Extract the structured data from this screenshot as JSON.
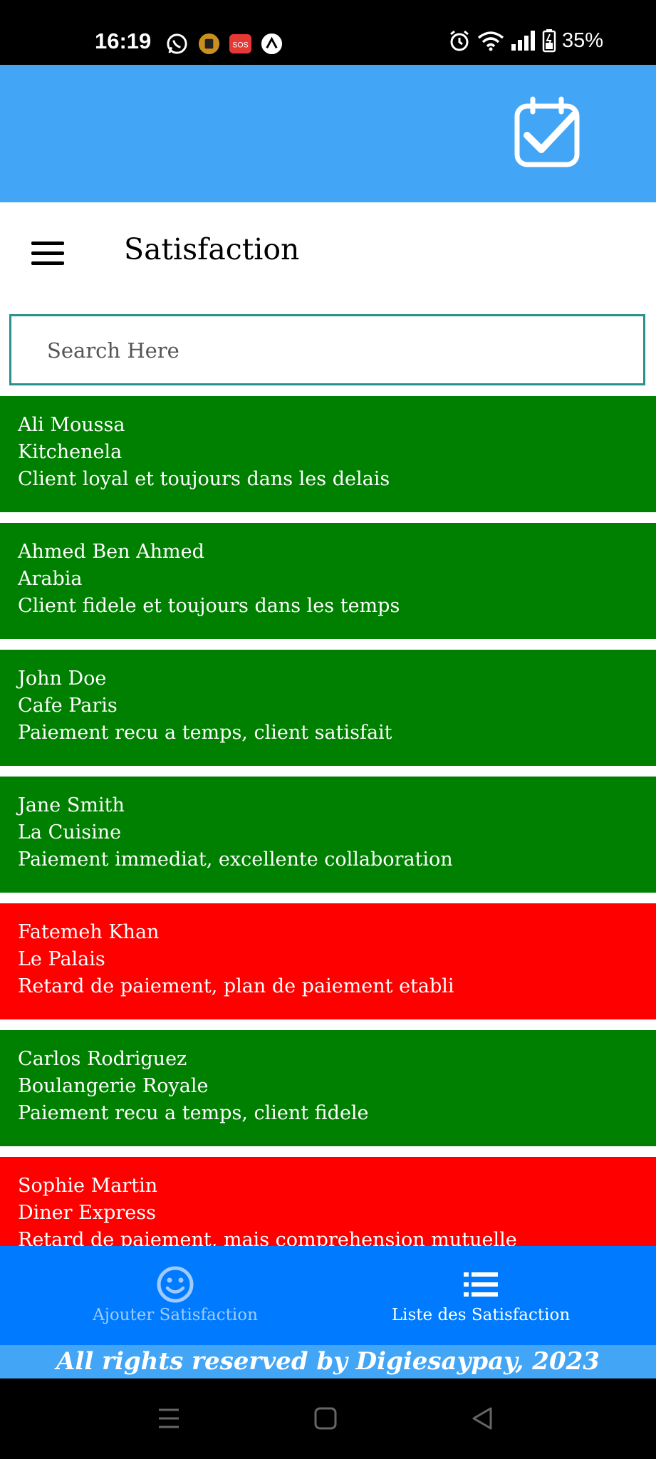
{
  "status_bar": {
    "time": "16:19",
    "battery": "35%",
    "icons_left": [
      "whatsapp-icon",
      "app-icon",
      "sos-icon",
      "nav-app-icon"
    ],
    "icons_right": [
      "alarm-icon",
      "wifi-icon",
      "signal-icon",
      "battery-icon"
    ]
  },
  "app_bar": {
    "icon": "calendar-check-icon",
    "color": "#42a5f5"
  },
  "header": {
    "title": "Satisfaction",
    "menu_icon": "hamburger-menu-icon"
  },
  "search": {
    "placeholder": "Search Here"
  },
  "colors": {
    "positive": "#008000",
    "negative": "#ff0000",
    "nav": "#007bff"
  },
  "records": [
    {
      "name": "Ali Moussa",
      "company": "Kitchenela",
      "comment": "Client loyal et toujours dans les delais",
      "status": "positive"
    },
    {
      "name": "Ahmed Ben Ahmed",
      "company": "Arabia",
      "comment": "Client fidele et toujours dans les temps",
      "status": "positive"
    },
    {
      "name": "John Doe",
      "company": "Cafe Paris",
      "comment": "Paiement recu a temps, client satisfait",
      "status": "positive"
    },
    {
      "name": "Jane Smith",
      "company": "La Cuisine",
      "comment": "Paiement immediat, excellente collaboration",
      "status": "positive"
    },
    {
      "name": "Fatemeh Khan",
      "company": "Le Palais",
      "comment": "Retard de paiement, plan de paiement etabli",
      "status": "negative"
    },
    {
      "name": "Carlos Rodriguez",
      "company": "Boulangerie Royale",
      "comment": "Paiement recu a temps, client fidele",
      "status": "positive"
    },
    {
      "name": "Sophie Martin",
      "company": "Diner Express",
      "comment": "Retard de paiement, mais comprehension mutuelle",
      "status": "negative"
    }
  ],
  "bottom_nav": {
    "items": [
      {
        "label": "Ajouter Satisfaction",
        "icon": "smiley-face-icon",
        "active": false
      },
      {
        "label": "Liste des Satisfaction",
        "icon": "list-icon",
        "active": true
      }
    ]
  },
  "footer": {
    "text": "All rights reserved by Digiesaypay, 2023"
  },
  "system_nav": {
    "icons": [
      "recent-apps-icon",
      "home-icon",
      "back-icon"
    ]
  }
}
